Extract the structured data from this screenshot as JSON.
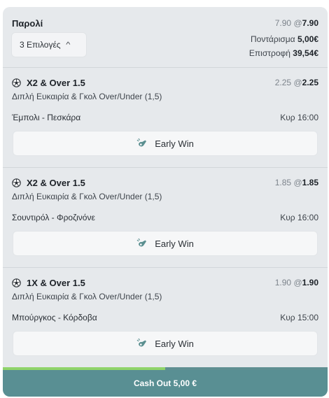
{
  "header": {
    "title": "Παρολί",
    "selections_button": "3 Επιλογές",
    "odds_old": "7.90",
    "odds_new": "7.90",
    "stake_label": "Ποντάρισμα",
    "stake_value": "5,00€",
    "return_label": "Επιστροφή",
    "return_value": "39,54€"
  },
  "selections": [
    {
      "title": "X2 & Over 1.5",
      "odds_old": "2.25",
      "odds_new": "2.25",
      "market": "Διπλή Ευκαιρία & Γκολ Over/Under (1,5)",
      "match": "Έμπολι - Πεσκάρα",
      "time": "Κυρ 16:00",
      "button": "Early Win"
    },
    {
      "title": "X2 & Over 1.5",
      "odds_old": "1.85",
      "odds_new": "1.85",
      "market": "Διπλή Ευκαιρία & Γκολ Over/Under (1,5)",
      "match": "Σουντιρόλ - Φροζινόνε",
      "time": "Κυρ 16:00",
      "button": "Early Win"
    },
    {
      "title": "1X & Over 1.5",
      "odds_old": "1.90",
      "odds_new": "1.90",
      "market": "Διπλή Ευκαιρία & Γκολ Over/Under (1,5)",
      "match": "Μπούργκος - Κόρδοβα",
      "time": "Κυρ 15:00",
      "button": "Early Win"
    }
  ],
  "cashout": {
    "label": "Cash Out 5,00 €",
    "progress": 0.5
  },
  "colors": {
    "card_bg": "#e6e9ec",
    "cashout_bg": "#598f93",
    "progress_fill": "#8fd36a",
    "early_win_icon": "#5b8f90"
  },
  "icons": {
    "selection": "soccer-ball-icon",
    "early_win": "early-win-whistle-icon",
    "selections_toggle": "chevron-up-icon"
  }
}
